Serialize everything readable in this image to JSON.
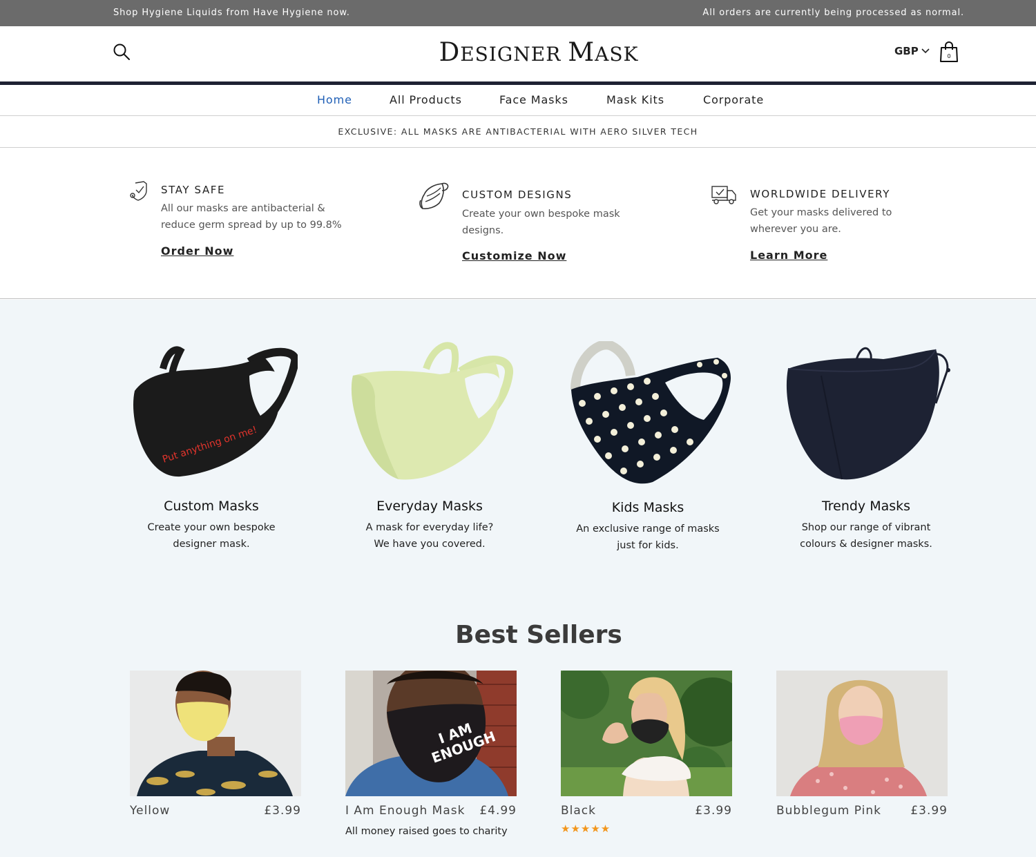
{
  "announcement": {
    "left_text": "Shop Hygiene Liquids from Have Hygiene now.",
    "right_text": "All orders are currently being processed as normal."
  },
  "header": {
    "logo_part1_cap": "D",
    "logo_part1_rest": "ESIGNER",
    "logo_part2_cap": "M",
    "logo_part2_rest": "ASK",
    "currency": "GBP",
    "cart_count": "0",
    "icons": [
      "search-icon",
      "chevron-down-icon",
      "shopping-bag-icon"
    ]
  },
  "nav": {
    "items": [
      {
        "label": "Home",
        "active": true
      },
      {
        "label": "All Products",
        "active": false
      },
      {
        "label": "Face Masks",
        "active": false
      },
      {
        "label": "Mask Kits",
        "active": false
      },
      {
        "label": "Corporate",
        "active": false
      }
    ],
    "active_color": "#1f5fb6"
  },
  "notice": {
    "text": "EXCLUSIVE: ALL MASKS ARE ANTIBACTERIAL WITH AERO SILVER TECH"
  },
  "features": [
    {
      "icon": "shield-check-icon",
      "title": "STAY SAFE",
      "description": "All our masks are antibacterial & reduce germ spread by up to 99.8%",
      "link": "Order Now"
    },
    {
      "icon": "mask-icon",
      "title": "CUSTOM DESIGNS",
      "description": "Create your own bespoke mask designs.",
      "link": "Customize Now"
    },
    {
      "icon": "delivery-truck-icon",
      "title": "WORLDWIDE DELIVERY",
      "description": "Get your masks delivered to wherever you are.",
      "link": "Learn More"
    }
  ],
  "categories": [
    {
      "title": "Custom Masks",
      "description": "Create your own bespoke designer mask.",
      "mask_print": "Put anything on me!"
    },
    {
      "title": "Everyday Masks",
      "description": "A mask for everyday life? We have you covered."
    },
    {
      "title": "Kids Masks",
      "description": "An exclusive range of masks just for kids."
    },
    {
      "title": "Trendy Masks",
      "description": "Shop our range of vibrant colours & designer masks."
    }
  ],
  "best_sellers": {
    "title": "Best Sellers",
    "products": [
      {
        "name": "Yellow",
        "price": "£3.99",
        "note": "",
        "mask_color": "#efe27a"
      },
      {
        "name": "I Am Enough Mask",
        "price": "£4.99",
        "note": "All money raised goes to charity",
        "mask_print_1": "I AM",
        "mask_print_2": "ENOUGH",
        "mask_color": "#1e1a1d"
      },
      {
        "name": "Black",
        "price": "£3.99",
        "note": "",
        "rating": "★★★★★",
        "mask_color": "#222"
      },
      {
        "name": "Bubblegum Pink",
        "price": "£3.99",
        "note": "",
        "mask_color": "#ef9fb5"
      }
    ]
  },
  "colors": {
    "announcement_bg": "#6b6b6b",
    "header_rule": "#1e2233",
    "category_bg": "#f1f6f9",
    "star": "#f2961d"
  }
}
